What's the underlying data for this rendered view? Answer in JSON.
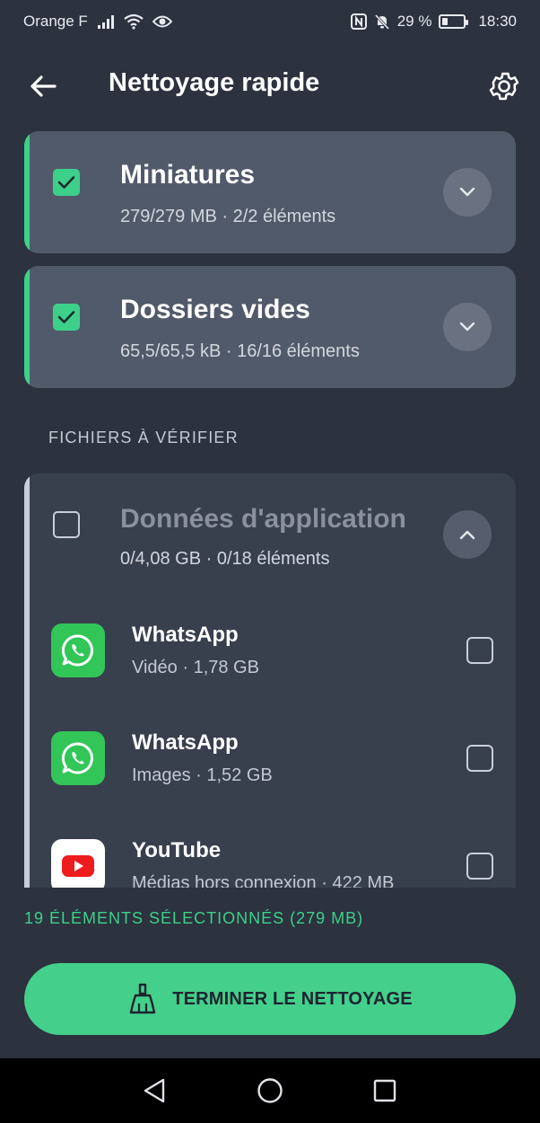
{
  "status_bar": {
    "carrier": "Orange F",
    "battery_text": "29 %",
    "battery_level": 0.29,
    "time": "18:30",
    "icons": [
      "signal-icon",
      "wifi-icon",
      "eye-icon",
      "nfc-icon",
      "bell-off-icon",
      "battery-icon"
    ]
  },
  "header": {
    "title": "Nettoyage rapide",
    "back_icon": "arrow-left-icon",
    "settings_icon": "gear-icon"
  },
  "cards": [
    {
      "title": "Miniatures",
      "subtitle": "279/279 MB · 2/2 éléments",
      "checked": true
    },
    {
      "title": "Dossiers vides",
      "subtitle": "65,5/65,5 kB · 16/16 éléments",
      "checked": true
    }
  ],
  "section_label": "FICHIERS À VÉRIFIER",
  "app_data_card": {
    "title": "Données d'application",
    "subtitle": "0/4,08 GB · 0/18 éléments",
    "checked": false,
    "items": [
      {
        "name": "WhatsApp",
        "detail": "Vidéo · 1,78 GB",
        "icon": "whatsapp-icon"
      },
      {
        "name": "WhatsApp",
        "detail": "Images · 1,52 GB",
        "icon": "whatsapp-icon"
      },
      {
        "name": "YouTube",
        "detail": "Médias hors connexion · 422 MB",
        "icon": "youtube-icon"
      }
    ]
  },
  "selection": {
    "summary": "19 ÉLÉMENTS SÉLECTIONNÉS (279 MB)"
  },
  "finish_button": {
    "label": "TERMINER LE NETTOYAGE",
    "icon": "broom-icon"
  },
  "colors": {
    "accent": "#3dd08b",
    "background": "#2c323e",
    "card": "#515a6a"
  }
}
